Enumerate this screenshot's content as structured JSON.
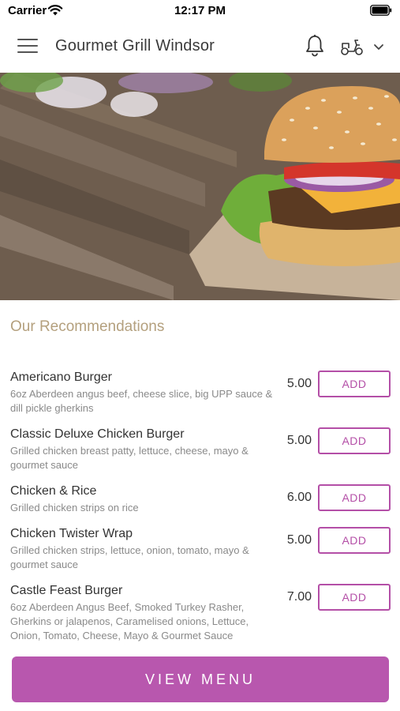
{
  "status_bar": {
    "carrier": "Carrier",
    "time": "12:17 PM"
  },
  "header": {
    "title": "Gourmet Grill Windsor",
    "icons": [
      "hamburger-menu-icon",
      "bell-icon",
      "scooter-icon",
      "chevron-down-icon"
    ]
  },
  "hero": {
    "image": "burger-photo"
  },
  "recommendations": {
    "title": "Our Recommendations",
    "items": [
      {
        "name": "Americano Burger",
        "description": "6oz Aberdeen angus beef, cheese slice, big UPP sauce & dill pickle gherkins",
        "price": "5.00",
        "add_label": "ADD"
      },
      {
        "name": "Classic Deluxe Chicken Burger",
        "description": "Grilled chicken breast patty, lettuce, cheese, mayo & gourmet sauce",
        "price": "5.00",
        "add_label": "ADD"
      },
      {
        "name": "Chicken & Rice",
        "description": "Grilled chicken strips on rice",
        "price": "6.00",
        "add_label": "ADD"
      },
      {
        "name": "Chicken Twister Wrap",
        "description": "Grilled chicken strips, lettuce, onion, tomato, mayo & gourmet sauce",
        "price": "5.00",
        "add_label": "ADD"
      },
      {
        "name": "Castle Feast Burger",
        "description": "6oz Aberdeen Angus Beef, Smoked Turkey Rasher, Gherkins or jalapenos, Caramelised onions, Lettuce, Onion, Tomato, Cheese, Mayo & Gourmet Sauce",
        "price": "7.00",
        "add_label": "ADD"
      }
    ]
  },
  "footer": {
    "view_menu_label": "VIEW MENU"
  },
  "colors": {
    "accent": "#b857ae",
    "section_title": "#b4a07e"
  }
}
